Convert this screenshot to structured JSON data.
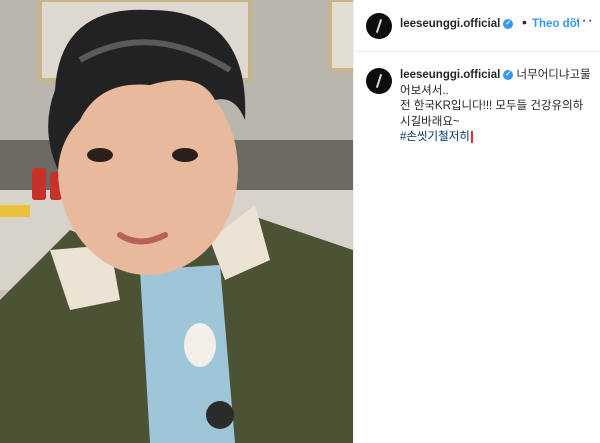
{
  "post": {
    "username": "leeseunggi.official",
    "verified_icon": "verified-badge-icon",
    "separator": "•",
    "follow_label": "Theo dõi",
    "more_icon": "ellipsis-icon",
    "more_glyph": "···",
    "caption_lines": [
      "너무어디냐고물",
      "어보셔서..",
      "전 한국KR입니다!!! 모두들 건강유의하",
      "시길바래요~"
    ],
    "hashtag": "#손씻기철저히",
    "colors": {
      "link": "#3897f0",
      "hashtag": "#003569",
      "text": "#262626"
    }
  }
}
